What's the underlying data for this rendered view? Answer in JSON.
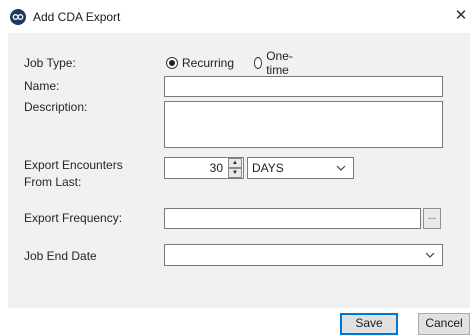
{
  "window": {
    "title": "Add CDA Export",
    "close_label": "✕"
  },
  "form": {
    "job_type": {
      "label": "Job Type:",
      "options": [
        "Recurring",
        "One-time"
      ],
      "selected": "Recurring"
    },
    "name": {
      "label": "Name:",
      "value": ""
    },
    "description": {
      "label": "Description:",
      "value": ""
    },
    "export_encounters": {
      "label_line1": "Export Encounters",
      "label_line2": "From Last:",
      "value": "30",
      "unit": "DAYS"
    },
    "export_frequency": {
      "label": "Export Frequency:",
      "value": "",
      "browse_label": "..."
    },
    "job_end_date": {
      "label": "Job End Date",
      "value": ""
    }
  },
  "footer": {
    "save_label": "Save",
    "cancel_label": "Cancel"
  },
  "colors": {
    "accent": "#0078d7",
    "panel": "#f1f1f1",
    "icon_bg": "#1f3a5f"
  }
}
